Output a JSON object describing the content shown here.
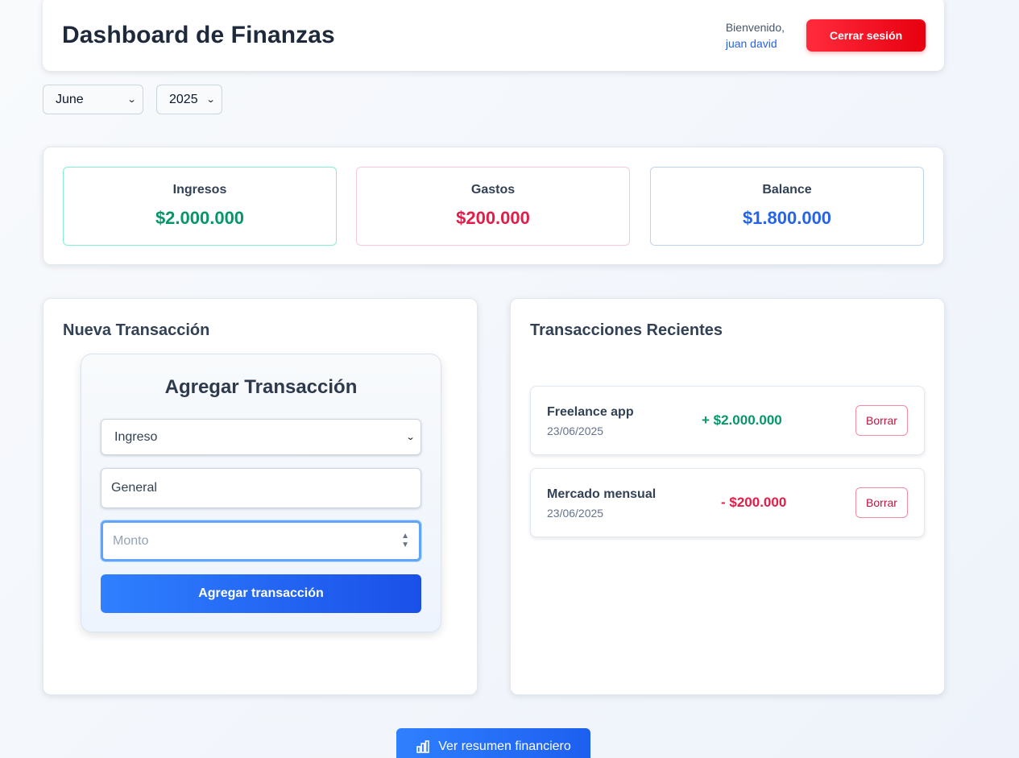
{
  "header": {
    "title": "Dashboard de Finanzas",
    "welcome_label": "Bienvenido,",
    "user_name": "juan david",
    "logout_label": "Cerrar sesión"
  },
  "filters": {
    "month": "June",
    "year": "2025"
  },
  "summary": {
    "income_label": "Ingresos",
    "income_value": "$2.000.000",
    "expense_label": "Gastos",
    "expense_value": "$200.000",
    "balance_label": "Balance",
    "balance_value": "$1.800.000"
  },
  "new_transaction": {
    "panel_title": "Nueva Transacción",
    "form_title": "Agregar Transacción",
    "type_value": "Ingreso",
    "category_value": "General",
    "amount_placeholder": "Monto",
    "submit_label": "Agregar transacción"
  },
  "recent": {
    "panel_title": "Transacciones Recientes",
    "delete_label": "Borrar",
    "items": [
      {
        "description": "Freelance app",
        "date": "23/06/2025",
        "amount": "+ $2.000.000"
      },
      {
        "description": "Mercado mensual",
        "date": "23/06/2025",
        "amount": "- $200.000"
      }
    ]
  },
  "footer": {
    "summary_button_label": "Ver resumen financiero"
  },
  "colors": {
    "income": "#059669",
    "expense": "#e11d48",
    "balance": "#2563eb",
    "primary": "#2f80ff",
    "danger": "#e8000f"
  },
  "icons": {
    "summary_button": "bar-chart-icon",
    "select_arrow": "chevron-down-icon",
    "number_spinner": "spinner-arrows-icon"
  }
}
